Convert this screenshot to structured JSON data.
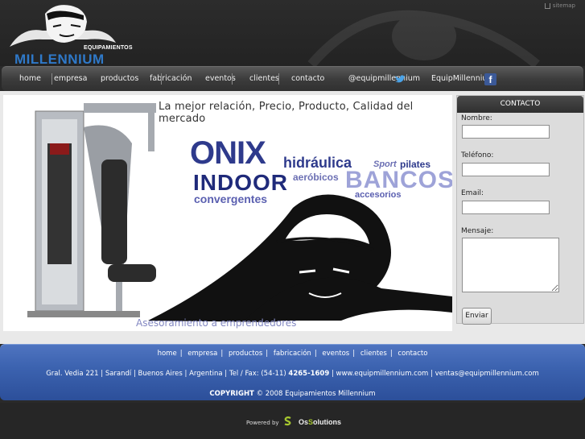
{
  "header": {
    "logo_top": "EQUIPAMIENTOS",
    "logo_brand": "MILLENNIUM",
    "sitemap": "sitemap"
  },
  "nav": {
    "items": [
      "home",
      "empresa",
      "productos",
      "fabricación",
      "eventos",
      "clientes",
      "contacto"
    ],
    "twitter": "@equipmillennium",
    "facebook": "EquipMillennium"
  },
  "banner": {
    "tagline": "La mejor relación, Precio, Producto, Calidad del mercado",
    "words": {
      "onix": "ONIX",
      "hidraulica": "hidráulica",
      "sport": "Sport",
      "pilates": "pilates",
      "indoor": "INDOOR",
      "aerobicos": "aeróbicos",
      "bancos": "BANCOS",
      "convergentes": "convergentes",
      "accesorios": "accesorios"
    },
    "footer_text": "Asesoramiento a emprendedores"
  },
  "contact": {
    "title": "CONTACTO",
    "name_label": "Nombre:",
    "phone_label": "Teléfono:",
    "email_label": "Email:",
    "message_label": "Mensaje:",
    "submit": "Enviar"
  },
  "footer": {
    "links": [
      "home",
      "empresa",
      "productos",
      "fabricación",
      "eventos",
      "clientes",
      "contacto"
    ],
    "address_prefix": "Gral. Vedia 221 | Sarandí | Buenos Aires | Argentina | Tel / Fax: (54-11)",
    "phone": "4265-1609",
    "web": "www.equipmillennium.com",
    "email": "ventas@equipmillennium.com",
    "copyright_label": "COPYRIGHT",
    "copyright_text": "© 2008 Equipamientos Millennium"
  },
  "powered": {
    "label": "Powered by",
    "brand_os": "Os",
    "brand_s": "S",
    "brand_rest": "olutions"
  },
  "colors": {
    "brand_blue": "#2f79c9",
    "footer_blue": "#3c63b0",
    "banner_navy": "#2e3a8c"
  }
}
